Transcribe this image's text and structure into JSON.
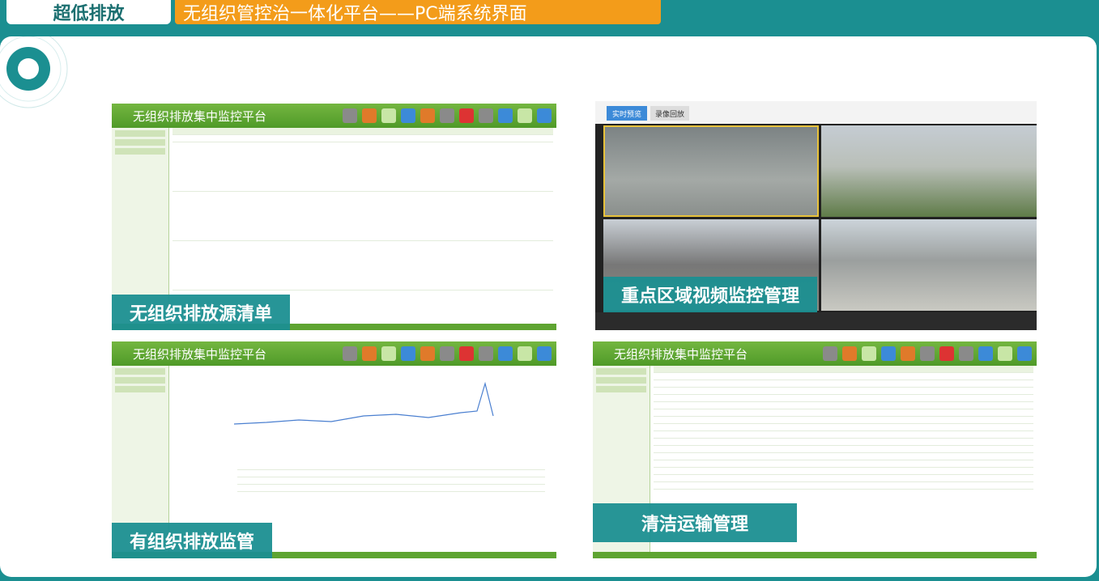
{
  "header": {
    "tag": "超低排放",
    "title": "无组织管控治一体化平台——PC端系统界面"
  },
  "screens": {
    "inventory": {
      "app_title": "无组织排放集中监控平台",
      "caption": "无组织排放源清单"
    },
    "video": {
      "tabs": [
        "实时预览",
        "录像回放"
      ],
      "caption": "重点区域视频监控管理"
    },
    "organized": {
      "app_title": "无组织排放集中监控平台",
      "caption": "有组织排放监管"
    },
    "transport": {
      "app_title": "无组织排放集中监控平台",
      "caption": "清洁运输管理"
    }
  },
  "colors": {
    "teal": "#1b8f91",
    "orange": "#f39c1a",
    "green": "#5ea431"
  }
}
